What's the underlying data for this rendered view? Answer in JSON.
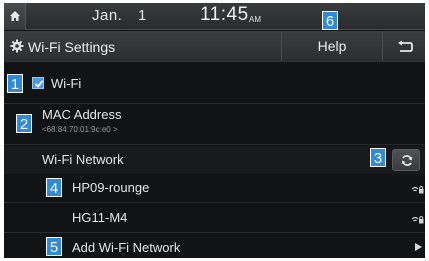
{
  "status_bar": {
    "home_icon": "home-icon",
    "date_month": "Jan.",
    "date_day": "1",
    "time": "11:45",
    "ampm": "AM"
  },
  "header": {
    "title": "Wi-Fi Settings",
    "help_label": "Help",
    "back_icon": "back-icon"
  },
  "wifi_toggle": {
    "label": "Wi-Fi",
    "checked": true
  },
  "mac": {
    "label": "MAC Address",
    "value": "<68:84:70:01:9c:e0 >"
  },
  "network_section": {
    "label": "Wi-Fi Network"
  },
  "networks": [
    {
      "name": "HP09-rounge",
      "icon": "wifi-lock-icon"
    },
    {
      "name": "HG11-M4",
      "icon": "wifi-lock-icon"
    }
  ],
  "add_network": {
    "label": "Add Wi-Fi Network"
  },
  "callouts": [
    "1",
    "2",
    "3",
    "4",
    "5",
    "6"
  ],
  "colors": {
    "callout": "#2f8ad8",
    "background": "#121314",
    "checkbox": "#4a9be0"
  }
}
